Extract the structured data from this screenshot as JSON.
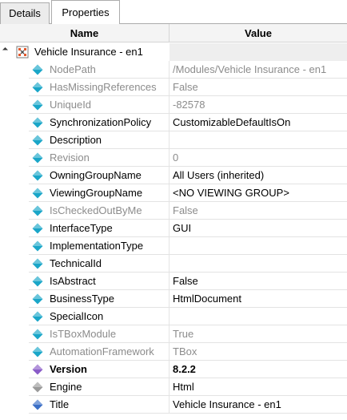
{
  "tabs": [
    {
      "label": "Details",
      "active": false
    },
    {
      "label": "Properties",
      "active": true
    }
  ],
  "columns": {
    "name": "Name",
    "value": "Value"
  },
  "root": {
    "label": "Vehicle Insurance - en1"
  },
  "colors": {
    "diamond_cyan": "#1aa6c8",
    "diamond_purple": "#8a5cc8",
    "diamond_gray": "#9a9a9a",
    "diamond_blue": "#3b6fc6",
    "readonly_text": "#8c8c8c"
  },
  "properties": [
    {
      "name": "NodePath",
      "value": "/Modules/Vehicle Insurance - en1",
      "readonly": true,
      "bold": false,
      "icon": "cyan-diamond-icon"
    },
    {
      "name": "HasMissingReferences",
      "value": "False",
      "readonly": true,
      "bold": false,
      "icon": "cyan-diamond-icon"
    },
    {
      "name": "UniqueId",
      "value": "-82578",
      "readonly": true,
      "bold": false,
      "icon": "cyan-diamond-icon"
    },
    {
      "name": "SynchronizationPolicy",
      "value": "CustomizableDefaultIsOn",
      "readonly": false,
      "bold": false,
      "icon": "cyan-diamond-icon"
    },
    {
      "name": "Description",
      "value": "",
      "readonly": false,
      "bold": false,
      "icon": "cyan-diamond-icon"
    },
    {
      "name": "Revision",
      "value": "0",
      "readonly": true,
      "bold": false,
      "icon": "cyan-diamond-icon"
    },
    {
      "name": "OwningGroupName",
      "value": "All Users (inherited)",
      "readonly": false,
      "bold": false,
      "icon": "cyan-diamond-icon"
    },
    {
      "name": "ViewingGroupName",
      "value": "<NO VIEWING GROUP>",
      "readonly": false,
      "bold": false,
      "icon": "cyan-diamond-icon"
    },
    {
      "name": "IsCheckedOutByMe",
      "value": "False",
      "readonly": true,
      "bold": false,
      "icon": "cyan-diamond-icon"
    },
    {
      "name": "InterfaceType",
      "value": "GUI",
      "readonly": false,
      "bold": false,
      "icon": "cyan-diamond-icon"
    },
    {
      "name": "ImplementationType",
      "value": "",
      "readonly": false,
      "bold": false,
      "icon": "cyan-diamond-icon"
    },
    {
      "name": "TechnicalId",
      "value": "",
      "readonly": false,
      "bold": false,
      "icon": "cyan-diamond-icon"
    },
    {
      "name": "IsAbstract",
      "value": "False",
      "readonly": false,
      "bold": false,
      "icon": "cyan-diamond-icon"
    },
    {
      "name": "BusinessType",
      "value": "HtmlDocument",
      "readonly": false,
      "bold": false,
      "icon": "cyan-diamond-icon"
    },
    {
      "name": "SpecialIcon",
      "value": "",
      "readonly": false,
      "bold": false,
      "icon": "cyan-diamond-icon"
    },
    {
      "name": "IsTBoxModule",
      "value": "True",
      "readonly": true,
      "bold": false,
      "icon": "cyan-diamond-icon"
    },
    {
      "name": "AutomationFramework",
      "value": "TBox",
      "readonly": true,
      "bold": false,
      "icon": "cyan-diamond-icon"
    },
    {
      "name": "Version",
      "value": "8.2.2",
      "readonly": false,
      "bold": true,
      "icon": "purple-diamond-icon"
    },
    {
      "name": "Engine",
      "value": "Html",
      "readonly": false,
      "bold": false,
      "icon": "gray-diamond-icon"
    },
    {
      "name": "Title",
      "value": "Vehicle Insurance - en1",
      "readonly": false,
      "bold": false,
      "icon": "blue-diamond-icon"
    }
  ]
}
